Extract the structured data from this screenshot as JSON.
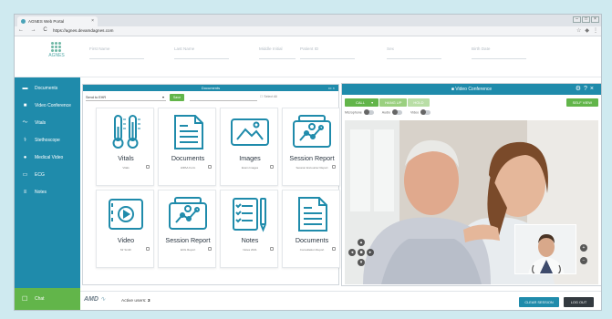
{
  "browser": {
    "tab_title": "AGNES Web Portal",
    "tab_close": "×",
    "url": "https://agnes.devamdagnes.com",
    "nav_glyphs": "← → C",
    "window_buttons": [
      "–",
      "□",
      "×"
    ]
  },
  "header": {
    "logo_text": "AGNES",
    "fields": [
      "First Name",
      "Last Name",
      "Middle Initial",
      "Patient ID",
      "Sex",
      "Birth Date"
    ]
  },
  "sidebar": {
    "items": [
      {
        "label": "Documents",
        "icon": "folder-icon"
      },
      {
        "label": "Video Conference",
        "icon": "video-camera-icon"
      },
      {
        "label": "Vitals",
        "icon": "chart-line-icon"
      },
      {
        "label": "Stethoscope",
        "icon": "stethoscope-icon"
      },
      {
        "label": "Medical Video",
        "icon": "user-icon"
      },
      {
        "label": "ECG",
        "icon": "ecg-icon"
      },
      {
        "label": "Notes",
        "icon": "notes-icon"
      }
    ],
    "chat_label": "Chat"
  },
  "documents_panel": {
    "title": "Documents",
    "select_value": "Send to EHR",
    "save_label": "Save",
    "filter_label": "Select All",
    "cards": [
      {
        "label": "Vitals",
        "sub": "Vitals",
        "icon": "thermometer-icon"
      },
      {
        "label": "Documents",
        "sub": "HIPAA Form",
        "icon": "document-icon"
      },
      {
        "label": "Images",
        "sub": "Exam Images",
        "icon": "image-icon"
      },
      {
        "label": "Session Report",
        "sub": "Session Encounter Report",
        "icon": "session-report-icon"
      },
      {
        "label": "Video",
        "sub": "Mr Smith",
        "icon": "video-file-icon"
      },
      {
        "label": "Session Report",
        "sub": "ECG Report",
        "icon": "session-report-icon"
      },
      {
        "label": "Notes",
        "sub": "Notes 2021",
        "icon": "notes-pen-icon"
      },
      {
        "label": "Documents",
        "sub": "Consultation Report",
        "icon": "document-icon"
      }
    ]
  },
  "video_panel": {
    "title": "Video Conference",
    "controls": [
      "CALL",
      "HANG UP",
      "HOLD"
    ],
    "self_view_label": "SELF VIEW",
    "toggles": [
      "Microphone",
      "Audio",
      "Video"
    ],
    "colors": {
      "call": "#62b54a",
      "hangup": "#9ad07f",
      "hold": "#b9dea6"
    }
  },
  "footer": {
    "logo_text": "AMD",
    "active_users_label": "Active users:",
    "active_users_count": "3",
    "clear_session_label": "CLEAR SESSION",
    "logout_label": "LOG OUT"
  },
  "colors": {
    "primary": "#1f8bab",
    "accent_green": "#62b54a"
  }
}
